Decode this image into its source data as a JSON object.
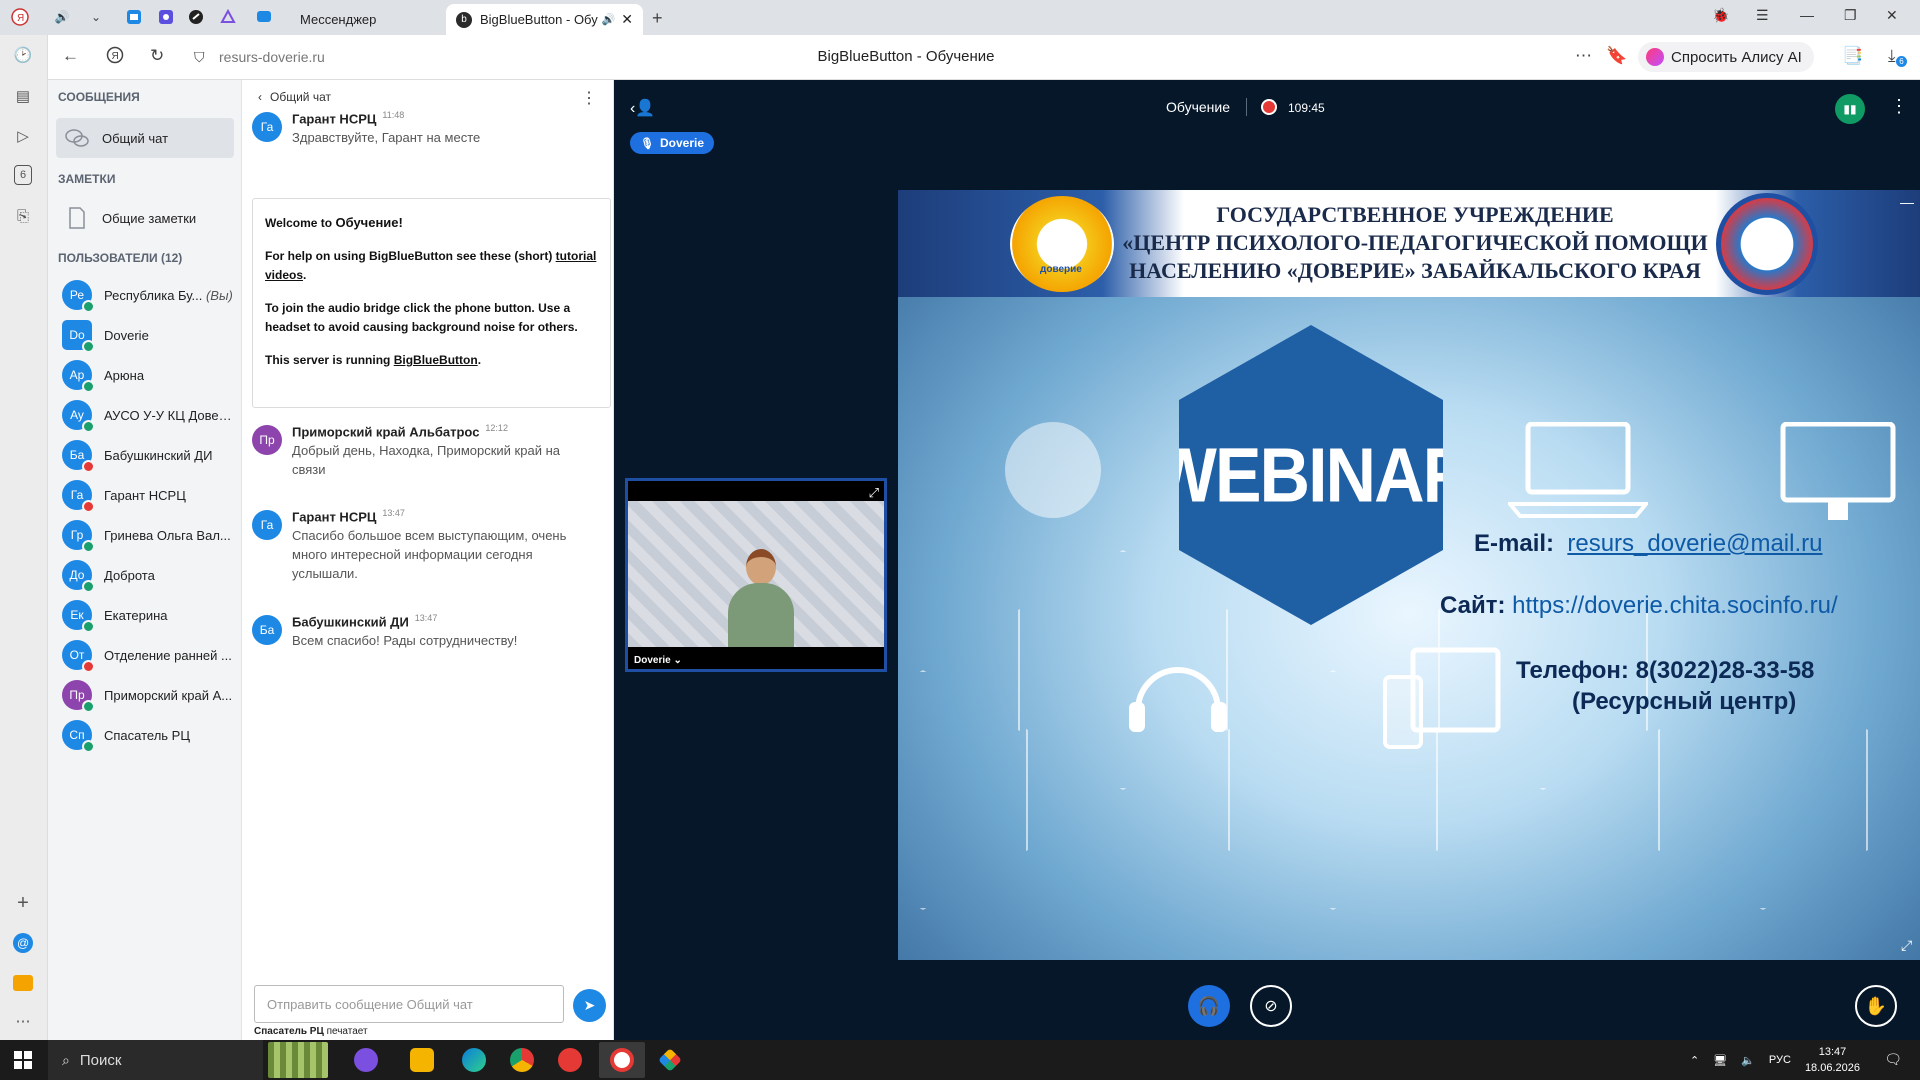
{
  "browser": {
    "tabs": [
      {
        "label": "Мессенджер"
      },
      {
        "label": "BigBlueButton - Обу",
        "active": true
      }
    ],
    "url": "resurs-doverie.ru",
    "page_title": "BigBlueButton - Обучение",
    "alice_label": "Спросить Алису AI",
    "downloads_badge": "6"
  },
  "sidebar_left": {
    "icons": [
      "history-icon",
      "collections-icon",
      "video-icon",
      "tab-6-icon",
      "screenshot-icon",
      "add-icon",
      "mail-icon",
      "notes-icon",
      "more-icon"
    ],
    "tab_number": "6"
  },
  "bbb": {
    "messages_title": "СООБЩЕНИЯ",
    "public_chat_label": "Общий чат",
    "notes_title": "ЗАМЕТКИ",
    "shared_notes_label": "Общие заметки",
    "users_title": "ПОЛЬЗОВАТЕЛИ (12)",
    "users": [
      {
        "initials": "Ре",
        "name": "Республика Бу...",
        "you": "(Вы)",
        "color": "#1e88e5",
        "status": "#1aa06d"
      },
      {
        "initials": "Do",
        "name": "Doverie",
        "color": "#1e88e5",
        "status": "#1aa06d",
        "presenter": true
      },
      {
        "initials": "Ар",
        "name": "Арюна",
        "color": "#1e88e5",
        "status": "#1aa06d"
      },
      {
        "initials": "Ау",
        "name": "АУСО У-У КЦ Довер...",
        "color": "#1e88e5",
        "status": "#1aa06d"
      },
      {
        "initials": "Ба",
        "name": "Бабушкинский ДИ",
        "color": "#1e88e5",
        "status": "#e53935"
      },
      {
        "initials": "Га",
        "name": "Гарант НСРЦ",
        "color": "#1e88e5",
        "status": "#e53935"
      },
      {
        "initials": "Гр",
        "name": "Гринева Ольга Вал...",
        "color": "#1e88e5",
        "status": "#1aa06d"
      },
      {
        "initials": "До",
        "name": "Доброта",
        "color": "#1e88e5",
        "status": "#1aa06d"
      },
      {
        "initials": "Ек",
        "name": "Екатерина",
        "color": "#1e88e5",
        "status": "#1aa06d"
      },
      {
        "initials": "От",
        "name": "Отделение ранней ...",
        "color": "#1e88e5",
        "status": "#e53935"
      },
      {
        "initials": "Пр",
        "name": "Приморский край А...",
        "color": "#8e44ad",
        "status": "#1aa06d"
      },
      {
        "initials": "Сп",
        "name": "Спасатель РЦ",
        "color": "#1e88e5",
        "status": "#1aa06d"
      }
    ]
  },
  "chat": {
    "header": "Общий чат",
    "messages": [
      {
        "initials": "Га",
        "color": "#1e88e5",
        "author": "Гарант НСРЦ",
        "time": "11:48",
        "text": "Здравствуйте, Гарант на месте"
      },
      {
        "initials": "Пр",
        "color": "#8e44ad",
        "author": "Приморский край Альбатрос",
        "time": "12:12",
        "text": "Добрый день, Находка, Приморский край на связи"
      },
      {
        "initials": "Га",
        "color": "#1e88e5",
        "author": "Гарант НСРЦ",
        "time": "13:47",
        "text": "Спасибо большое всем выступающим, очень много интересной информации сегодня услышали."
      },
      {
        "initials": "Ба",
        "color": "#1e88e5",
        "author": "Бабушкинский ДИ",
        "time": "13:47",
        "text": "Всем спасибо! Рады сотрудничеству!"
      }
    ],
    "welcome": {
      "line1_prefix": "Welcome to ",
      "line1_name": "Обучение!",
      "line2_prefix": "For help on using BigBlueButton see these (short) ",
      "line2_link": "tutorial videos",
      "line2_suffix": ".",
      "line3": "To join the audio bridge click the phone button. Use a headset to avoid causing background noise for others.",
      "line4_prefix": "This server is running ",
      "line4_link": "BigBlueButton",
      "line4_suffix": "."
    },
    "input_placeholder": "Отправить сообщение Общий чат",
    "typing_name": "Спасатель РЦ",
    "typing_suffix": "печатает"
  },
  "meeting": {
    "title": "Обучение",
    "recording_time": "109:45",
    "talking_user": "Doverie",
    "webcam_name": "Doverie"
  },
  "slide": {
    "banner_line1": "ГОСУДАРСТВЕННОЕ УЧРЕЖДЕНИЕ",
    "banner_line2": "«ЦЕНТР ПСИХОЛОГО-ПЕДАГОГИЧЕСКОЙ ПОМОЩИ",
    "banner_line3": "НАСЕЛЕНИЮ «ДОВЕРИЕ» ЗАБАЙКАЛЬСКОГО КРАЯ",
    "logo_text": "доверие",
    "webinar": "WEBINAR",
    "email_label": "E-mail:",
    "email": "resurs_doverie@mail.ru",
    "site_label": "Сайт:",
    "site": "https://doverie.chita.socinfo.ru/",
    "phone": "Телефон: 8(3022)28-33-58",
    "resource": "(Ресурсный центр)"
  },
  "taskbar": {
    "search": "Поиск",
    "lang": "РУС",
    "time": "13:47",
    "date": "18.06.2026"
  }
}
